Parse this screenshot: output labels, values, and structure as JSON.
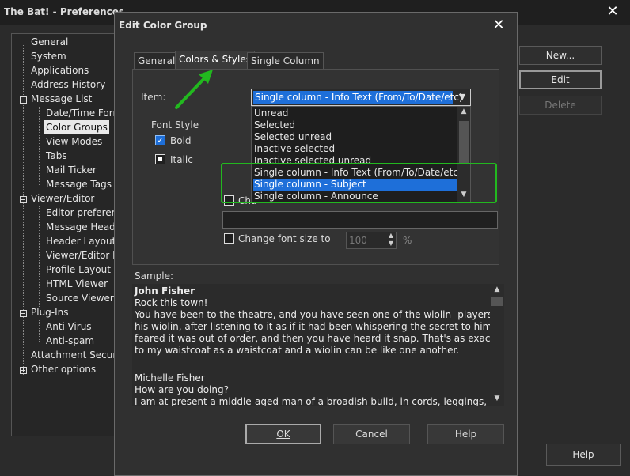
{
  "window": {
    "title": "The Bat! - Preferences",
    "close_glyph": "✕"
  },
  "tree": {
    "items": [
      {
        "label": "General"
      },
      {
        "label": "System"
      },
      {
        "label": "Applications"
      },
      {
        "label": "Address History"
      },
      {
        "label": "Message List"
      },
      {
        "label": "Date/Time Form"
      },
      {
        "label": "Color Groups"
      },
      {
        "label": "View Modes"
      },
      {
        "label": "Tabs"
      },
      {
        "label": "Mail Ticker"
      },
      {
        "label": "Message Tags"
      },
      {
        "label": "Viewer/Editor"
      },
      {
        "label": "Editor preference"
      },
      {
        "label": "Message Header"
      },
      {
        "label": "Header Layout"
      },
      {
        "label": "Viewer/Editor Pr"
      },
      {
        "label": "Profile Layout"
      },
      {
        "label": "HTML Viewer"
      },
      {
        "label": "Source Viewer"
      },
      {
        "label": "Plug-Ins"
      },
      {
        "label": "Anti-Virus"
      },
      {
        "label": "Anti-spam"
      },
      {
        "label": "Attachment Security"
      },
      {
        "label": "Other options"
      }
    ]
  },
  "right_buttons": {
    "new": "New...",
    "edit": "Edit",
    "delete": "Delete",
    "help": "Help"
  },
  "dialog": {
    "title": "Edit Color Group",
    "close_glyph": "✕",
    "tabs": [
      {
        "label": "General"
      },
      {
        "label": "Colors & Styles"
      },
      {
        "label": "Single Column"
      }
    ],
    "item_label": "Item:",
    "item_selected": "Single column - Info Text (From/To/Date/etc)",
    "dropdown_items": [
      {
        "label": "Unread"
      },
      {
        "label": "Selected"
      },
      {
        "label": "Selected unread"
      },
      {
        "label": "Inactive selected"
      },
      {
        "label": "Inactive selected unread"
      },
      {
        "label": "Single column - Info Text (From/To/Date/etc)"
      },
      {
        "label": "Single column - Subject"
      },
      {
        "label": "Single column - Announce"
      }
    ],
    "font_style_label": "Font Style",
    "bold_label": "Bold",
    "italic_label": "Italic",
    "change_color_label": "Cha",
    "change_font_size_label": "Change font size to",
    "font_size_value": "100",
    "percent": "%",
    "sample_label": "Sample:",
    "sample_lines": [
      {
        "text": "John Fisher"
      },
      {
        "text": "Rock this town!"
      },
      {
        "text": "You have been to the theatre, and you have seen one of the wiolin- players screw up"
      },
      {
        "text": "his wiolin, after listening to it as if it had been whispering the secret to him that it"
      },
      {
        "text": "feared it was out of order, and then you have heard it snap. That's as exactly similar"
      },
      {
        "text": "to my waistcoat as a waistcoat and a wiolin can be like one another."
      },
      {
        "text": ""
      },
      {
        "text": "Michelle Fisher"
      },
      {
        "text": "How are you doing?"
      },
      {
        "text": "I am at present a middle-aged man of a broadish build, in cords, leggings, and a"
      }
    ],
    "ok_label": "OK",
    "cancel_label": "Cancel",
    "help_label": "Help"
  },
  "colors": {
    "accent": "#1e6fd9",
    "annotation": "#22b81f"
  }
}
